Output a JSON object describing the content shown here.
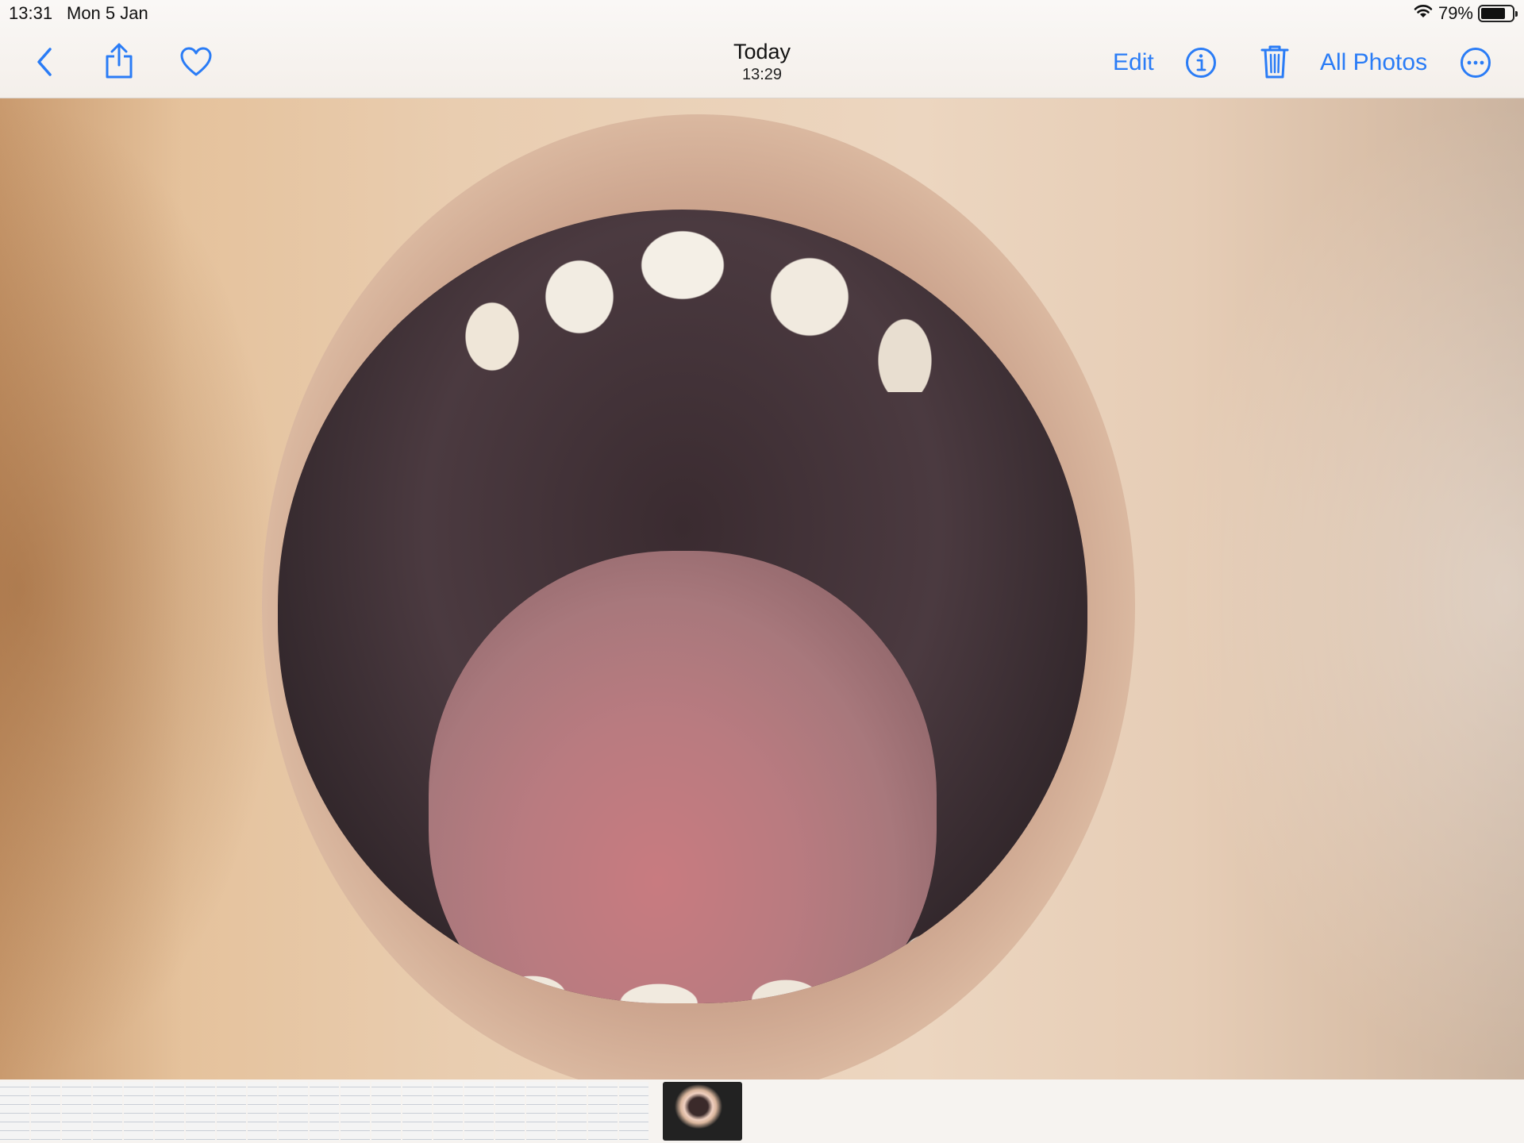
{
  "status_bar": {
    "time": "13:31",
    "date": "Mon 5 Jan",
    "wifi_icon": "wifi-icon",
    "battery_percent": "79%",
    "battery_level": 0.79
  },
  "nav": {
    "back_icon": "chevron-left-icon",
    "share_icon": "share-icon",
    "favorite_icon": "heart-icon",
    "title": "Today",
    "subtitle": "13:29",
    "edit_label": "Edit",
    "info_icon": "info-icon",
    "delete_icon": "trash-icon",
    "all_photos_label": "All Photos",
    "more_icon": "ellipsis-circle-icon"
  },
  "colors": {
    "accent": "#2a7cf6"
  },
  "photo": {
    "subject": "open-mouth-photo"
  },
  "filmstrip": {
    "thumbnail_count": 22,
    "current_index": 21
  }
}
